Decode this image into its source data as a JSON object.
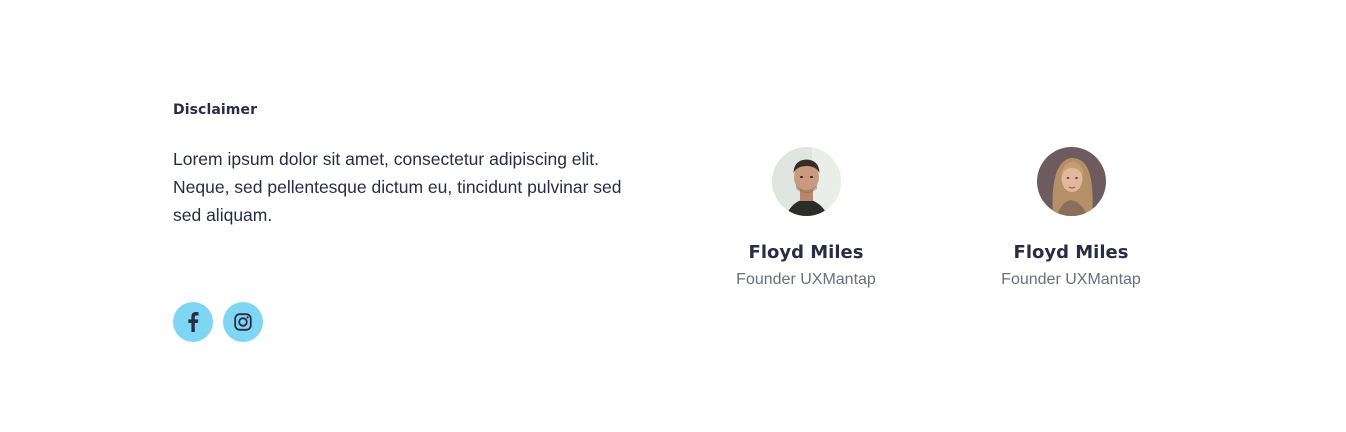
{
  "disclaimer": {
    "title": "Disclaimer",
    "text": "Lorem ipsum dolor sit amet, consectetur adipiscing elit. Neque, sed pellentesque dictum eu, tincidunt pulvinar sed sed aliquam."
  },
  "social": {
    "items": [
      {
        "icon": "facebook-icon"
      },
      {
        "icon": "instagram-icon"
      }
    ],
    "button_color": "#7fd6f2"
  },
  "team": [
    {
      "name": "Floyd Miles",
      "role": "Founder UXMantap",
      "avatar": "male-portrait"
    },
    {
      "name": "Floyd Miles",
      "role": "Founder UXMantap",
      "avatar": "female-portrait"
    }
  ],
  "colors": {
    "heading": "#2a2c45",
    "muted": "#6b6f7b"
  }
}
